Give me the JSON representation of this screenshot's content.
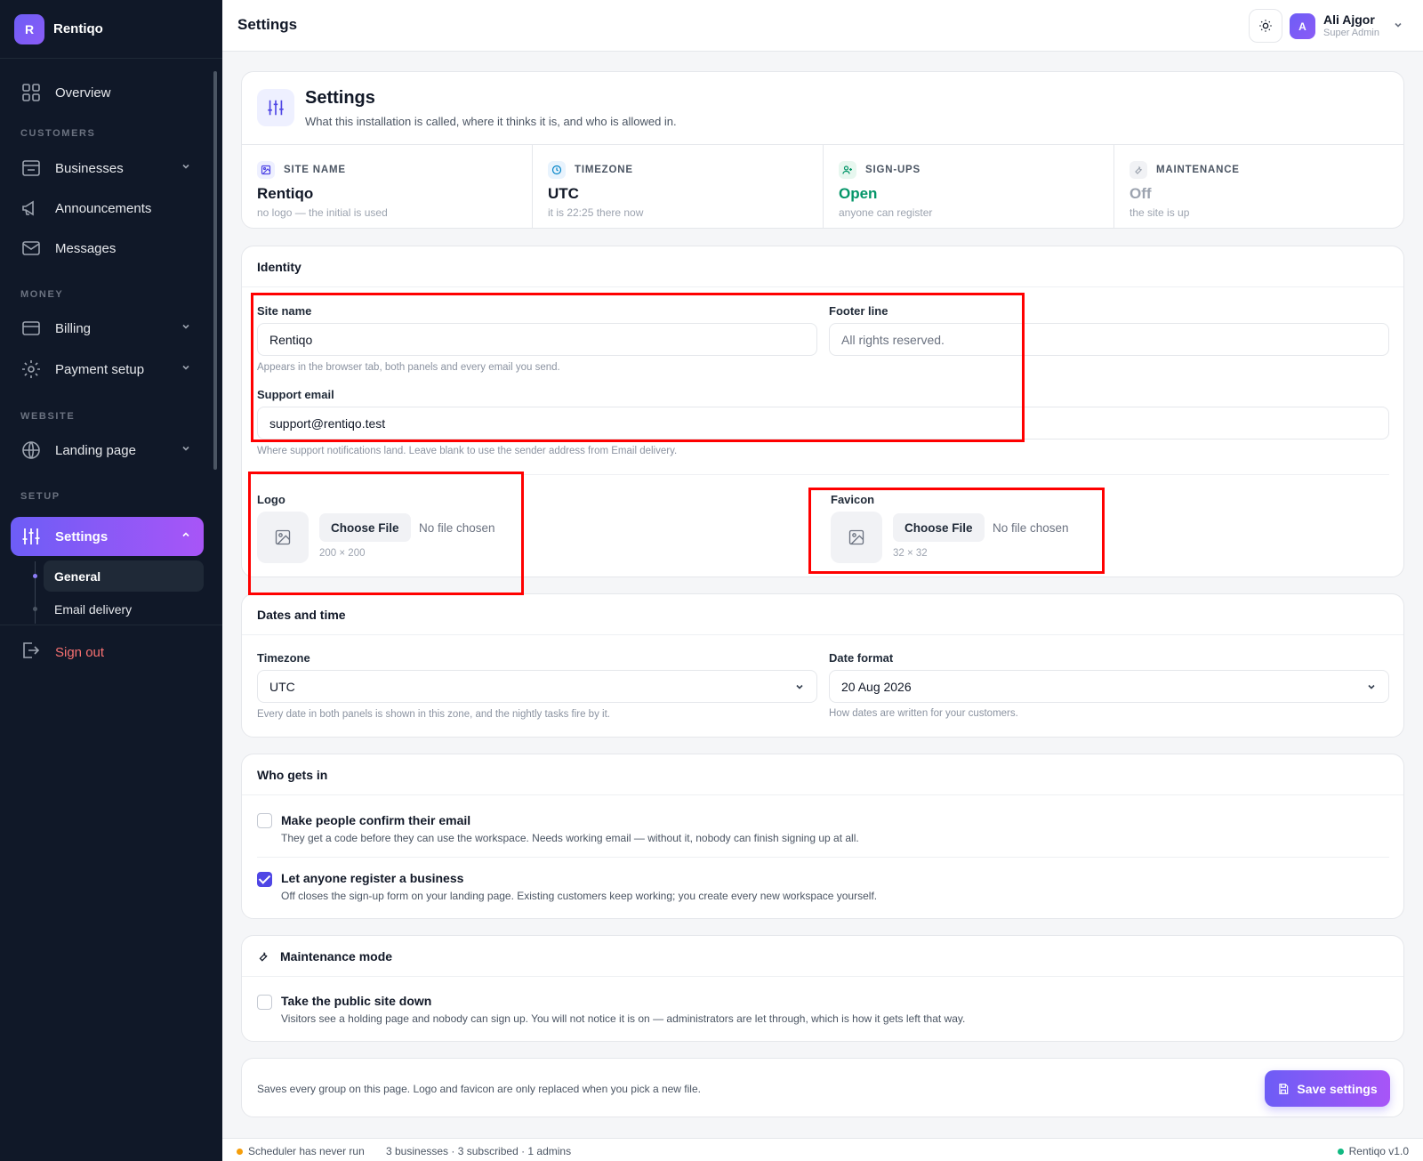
{
  "app": {
    "brand_initial": "R",
    "brand_name": "Rentiqo",
    "page_title": "Settings"
  },
  "sidebar": {
    "overview": "Overview",
    "section_customers": "CUSTOMERS",
    "businesses": "Businesses",
    "announcements": "Announcements",
    "messages": "Messages",
    "section_money": "MONEY",
    "billing": "Billing",
    "payment_setup": "Payment setup",
    "section_website": "WEBSITE",
    "landing_page": "Landing page",
    "section_setup": "SETUP",
    "settings": "Settings",
    "sub_general": "General",
    "sub_email": "Email delivery",
    "sign_out": "Sign out"
  },
  "user": {
    "initial": "A",
    "name": "Ali Ajgor",
    "role": "Super Admin"
  },
  "summary": {
    "title": "Settings",
    "subtitle": "What this installation is called, where it thinks it is, and who is allowed in.",
    "stats": [
      {
        "label": "SITE NAME",
        "value": "Rentiqo",
        "sub": "no logo — the initial is used"
      },
      {
        "label": "TIMEZONE",
        "value": "UTC",
        "sub": "it is 22:25 there now"
      },
      {
        "label": "SIGN-UPS",
        "value": "Open",
        "sub": "anyone can register"
      },
      {
        "label": "MAINTENANCE",
        "value": "Off",
        "sub": "the site is up"
      }
    ]
  },
  "identity": {
    "heading": "Identity",
    "site_name_label": "Site name",
    "site_name_value": "Rentiqo",
    "site_name_hint": "Appears in the browser tab, both panels and every email you send.",
    "footer_label": "Footer line",
    "footer_placeholder": "All rights reserved.",
    "support_label": "Support email",
    "support_value": "support@rentiqo.test",
    "support_hint": "Where support notifications land. Leave blank to use the sender address from Email delivery.",
    "logo_label": "Logo",
    "logo_button": "Choose File",
    "logo_status": "No file chosen",
    "logo_size": "200 × 200",
    "favicon_label": "Favicon",
    "favicon_button": "Choose File",
    "favicon_status": "No file chosen",
    "favicon_size": "32 × 32"
  },
  "dates": {
    "heading": "Dates and time",
    "timezone_label": "Timezone",
    "timezone_value": "UTC",
    "timezone_hint": "Every date in both panels is shown in this zone, and the nightly tasks fire by it.",
    "format_label": "Date format",
    "format_value": "20 Aug 2026",
    "format_hint": "How dates are written for your customers."
  },
  "access": {
    "heading": "Who gets in",
    "confirm_title": "Make people confirm their email",
    "confirm_desc": "They get a code before they can use the workspace. Needs working email — without it, nobody can finish signing up at all.",
    "confirm_checked": false,
    "register_title": "Let anyone register a business",
    "register_desc": "Off closes the sign-up form on your landing page. Existing customers keep working; you create every new workspace yourself.",
    "register_checked": true
  },
  "maintenance": {
    "heading": "Maintenance mode",
    "down_title": "Take the public site down",
    "down_desc": "Visitors see a holding page and nobody can sign up. You will not notice it is on — administrators are let through, which is how it gets left that way.",
    "down_checked": false
  },
  "footer_bar": {
    "note": "Saves every group on this page. Logo and favicon are only replaced when you pick a new file.",
    "save_label": "Save settings"
  },
  "status": {
    "scheduler": "Scheduler has never run",
    "counts": "3 businesses · 3 subscribed · 1 admins",
    "version": "Rentiqo v1.0"
  },
  "colors": {
    "accent": "#6d5df6",
    "open": "#059669",
    "off": "#9ca3af",
    "highlight": "#ff0000"
  }
}
